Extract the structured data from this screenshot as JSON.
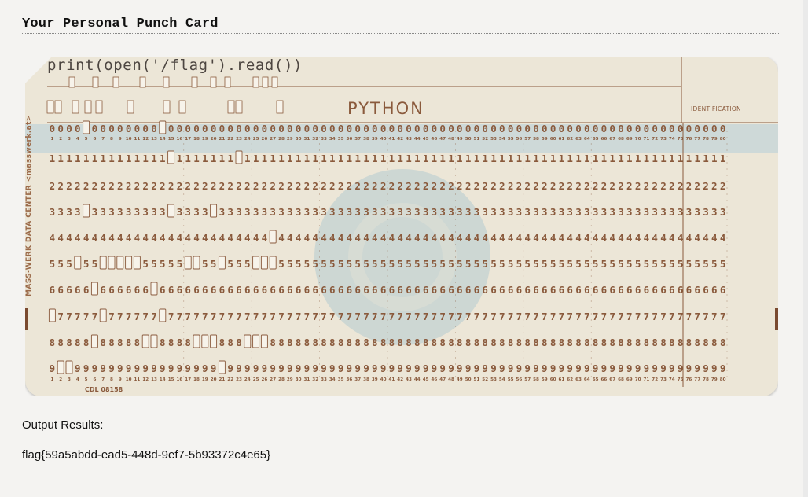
{
  "page": {
    "title": "Your Personal Punch Card"
  },
  "card": {
    "code": "print(open('/flag').read())",
    "language": "PYTHON",
    "identification_label": "IDENTIFICATION",
    "side_text": "MASS-WERK DATA CENTER  <masswerk.at>",
    "footer_label": "CDL   08158",
    "columns": 80,
    "row_digits": [
      "0",
      "1",
      "2",
      "3",
      "4",
      "5",
      "6",
      "7",
      "8",
      "9"
    ],
    "punches": {
      "12": [
        1,
        2,
        3,
        4,
        6,
        7,
        9,
        10,
        11,
        15,
        19,
        21
      ],
      "11": [
        5,
        7,
        13,
        14,
        20,
        21,
        22,
        23,
        24,
        25,
        26,
        27
      ],
      "0": [
        5,
        14
      ],
      "1": [
        15,
        23
      ],
      "2": [],
      "3": [
        5,
        15,
        20
      ],
      "4": [
        27
      ],
      "5": [
        4,
        7,
        8,
        9,
        10,
        11,
        17,
        18,
        21,
        25,
        26,
        27
      ],
      "6": [
        6,
        13
      ],
      "7": [
        1,
        7,
        14
      ],
      "8": [
        6,
        12,
        13,
        18,
        19,
        20,
        24,
        25,
        26
      ],
      "9": [
        2,
        3,
        21
      ]
    },
    "colors": {
      "card": "#ece6d7",
      "ink": "#8a5a3c",
      "highlight_band": "#c9d6d8",
      "watermark": "#a9c6cf"
    }
  },
  "output": {
    "label": "Output Results:",
    "value": "flag{59a5abdd-ead5-448d-9ef7-5b93372c4e65}"
  }
}
